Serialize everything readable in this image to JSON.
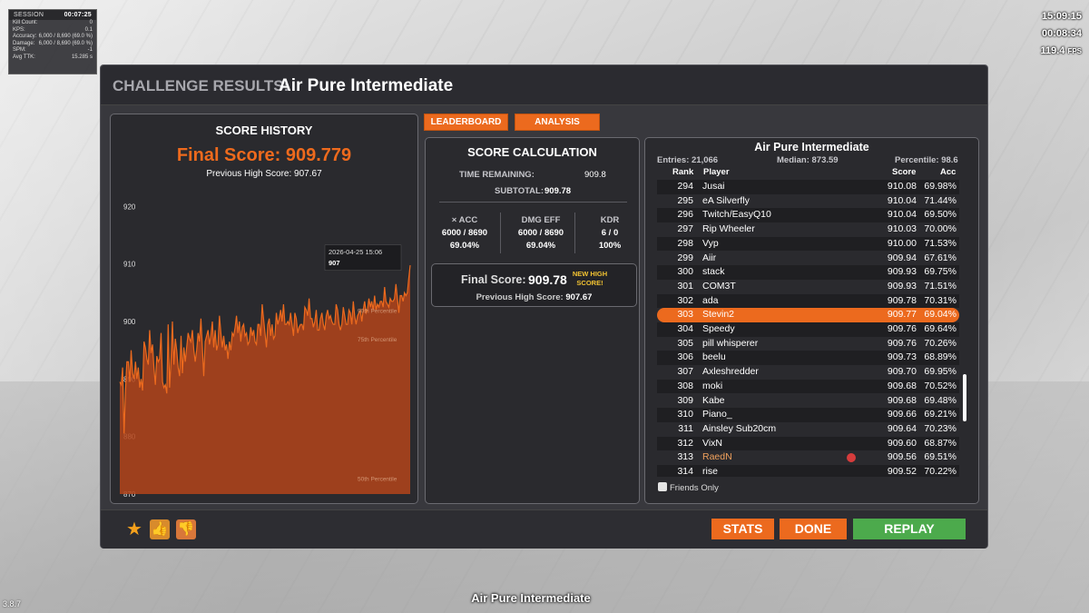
{
  "session": {
    "label": "SESSION",
    "time": "00:07:25",
    "stats": [
      {
        "k": "Kill Count:",
        "v": "0"
      },
      {
        "k": "KPS:",
        "v": "0.1"
      },
      {
        "k": "Accuracy:",
        "v": "6,000 / 8,690  (69.0 %)"
      },
      {
        "k": "Damage:",
        "v": "6,000 / 8,690  (69.0 %)"
      },
      {
        "k": "SPM:",
        "v": "-1"
      },
      {
        "k": "Avg TTK:",
        "v": "15.285 s"
      }
    ]
  },
  "hud": {
    "clock": "15:09:15",
    "timer": "00:08:34",
    "fps_value": "119.4",
    "fps_unit": "FPS"
  },
  "version": "3.8.7",
  "bottom_title": "Air Pure Intermediate",
  "window": {
    "label": "CHALLENGE RESULTS:",
    "name": "Air Pure Intermediate"
  },
  "history": {
    "title": "SCORE HISTORY",
    "final_score": "Final Score: 909.779",
    "previous_high": "Previous High Score: 907.67",
    "tooltip_date": "2026-04-25 15:06",
    "tooltip_value": "907",
    "percentile_labels": [
      "90th Percentile",
      "75th Percentile",
      "50th Percentile"
    ],
    "percentile_values": [
      901.5,
      896.5,
      872.3
    ]
  },
  "chart_data": {
    "type": "area",
    "title": "SCORE HISTORY",
    "yticks": [
      "920",
      "910",
      "900",
      "890",
      "880",
      "870"
    ],
    "ylim": [
      870,
      921
    ],
    "color": "#ec6a1e",
    "values": [
      889.5,
      889,
      892,
      880.5,
      888,
      893,
      893,
      889.5,
      895,
      891,
      890,
      893,
      890,
      892,
      888.5,
      890,
      888,
      896.5,
      895.5,
      893.5,
      892.5,
      898.5,
      894.5,
      896,
      892,
      889,
      894,
      893,
      893.5,
      898,
      889.5,
      888.5,
      889,
      887.5,
      899.5,
      888.5,
      893.5,
      900,
      892.5,
      897,
      895,
      892,
      890.5,
      897.5,
      891,
      895.5,
      893,
      895.5,
      898,
      897,
      896.5,
      898.5,
      895,
      893,
      895,
      898,
      896.5,
      900.5,
      895.5,
      890.5,
      896.5,
      897.5,
      898.5,
      896,
      897.5,
      900,
      895.5,
      898.5,
      895,
      896,
      901,
      898,
      895.5,
      897.5,
      895,
      896,
      893.5,
      896.5,
      895,
      898,
      897.5,
      899,
      901,
      898,
      900,
      896.5,
      899,
      899.5,
      897.5,
      898,
      896,
      896.5,
      899,
      897.5,
      898.5,
      896.5,
      896,
      899.5,
      899.5,
      897.5,
      903,
      900.5,
      898,
      895.5,
      899.5,
      900.5,
      897.5,
      899.5,
      897,
      897.5,
      901.5,
      899.5,
      900.5,
      902,
      900,
      903,
      899.5,
      899.5,
      900,
      899.5,
      901.5,
      899.5,
      897.5,
      901.5,
      900.5,
      898,
      899,
      899.5,
      899.5,
      898.5,
      902.5,
      902,
      901,
      904,
      900.5,
      900.5,
      899,
      900,
      902,
      898.5,
      898.5,
      900.5,
      901.5,
      899.5,
      898.5,
      901,
      902,
      900.5,
      901,
      900,
      899.5,
      899.5,
      903,
      902,
      899.5,
      898.5,
      899.5,
      902.5,
      901,
      899.5,
      899.5,
      902,
      901.5,
      899.5,
      903.5,
      901,
      899.5,
      901,
      901.5,
      902,
      900,
      902,
      903.5,
      901.5,
      902,
      904,
      902.5,
      903.5,
      902,
      904.5,
      902,
      903,
      902.5,
      903.5,
      903.5,
      902.5,
      906,
      903.5,
      903,
      902.5,
      904,
      903.5,
      903.5,
      904,
      906.5,
      904,
      901.5,
      904.5,
      904.5,
      903.5,
      905,
      904.5,
      905,
      907.5,
      909.779
    ]
  },
  "tabs": {
    "leaderboard": "LEADERBOARD",
    "analysis": "ANALYSIS"
  },
  "calc": {
    "title": "SCORE CALCULATION",
    "time_remaining_label": "TIME REMAINING:",
    "time_remaining_value": "909.8",
    "subtotal_label": "SUBTOTAL:",
    "subtotal_value": "909.78",
    "columns": [
      {
        "h": "× ACC",
        "v1": "6000 / 8690",
        "v2": "69.04%"
      },
      {
        "h": "DMG EFF",
        "v1": "6000 / 8690",
        "v2": "69.04%"
      },
      {
        "h": "KDR",
        "v1": "6 / 0",
        "v2": "100%"
      }
    ],
    "final_label": "Final Score:",
    "final_value": "909.78",
    "new_high_1": "NEW HIGH",
    "new_high_2": "SCORE!",
    "prev_label": "Previous High Score:",
    "prev_value": "907.67"
  },
  "leaderboard": {
    "title": "Air Pure Intermediate",
    "entries": "Entries: 21,066",
    "median": "Median: 873.59",
    "percentile": "Percentile: 98.6",
    "headers": {
      "rank": "Rank",
      "player": "Player",
      "score": "Score",
      "acc": "Acc"
    },
    "friends_only": "Friends Only",
    "rows": [
      {
        "rank": "294",
        "player": "Jusai",
        "score": "910.08",
        "acc": "69.98%"
      },
      {
        "rank": "295",
        "player": "eA Silverfly",
        "score": "910.04",
        "acc": "71.44%"
      },
      {
        "rank": "296",
        "player": "Twitch/EasyQ10",
        "score": "910.04",
        "acc": "69.50%"
      },
      {
        "rank": "297",
        "player": "Rip Wheeler",
        "score": "910.03",
        "acc": "70.00%"
      },
      {
        "rank": "298",
        "player": "Vyp",
        "score": "910.00",
        "acc": "71.53%"
      },
      {
        "rank": "299",
        "player": "Aiir",
        "score": "909.94",
        "acc": "67.61%"
      },
      {
        "rank": "300",
        "player": "stack",
        "score": "909.93",
        "acc": "69.75%"
      },
      {
        "rank": "301",
        "player": "COM3T",
        "score": "909.93",
        "acc": "71.51%"
      },
      {
        "rank": "302",
        "player": "ada",
        "score": "909.78",
        "acc": "70.31%"
      },
      {
        "rank": "303",
        "player": "Stevin2",
        "score": "909.77",
        "acc": "69.04%",
        "me": true
      },
      {
        "rank": "304",
        "player": "Speedy",
        "score": "909.76",
        "acc": "69.64%"
      },
      {
        "rank": "305",
        "player": "pill whisperer",
        "score": "909.76",
        "acc": "70.26%"
      },
      {
        "rank": "306",
        "player": "beelu",
        "score": "909.73",
        "acc": "68.89%"
      },
      {
        "rank": "307",
        "player": "Axleshredder",
        "score": "909.70",
        "acc": "69.95%"
      },
      {
        "rank": "308",
        "player": "moki",
        "score": "909.68",
        "acc": "70.52%"
      },
      {
        "rank": "309",
        "player": "Kabe",
        "score": "909.68",
        "acc": "69.48%"
      },
      {
        "rank": "310",
        "player": "Piano_",
        "score": "909.66",
        "acc": "69.21%"
      },
      {
        "rank": "311",
        "player": "Ainsley Sub20cm",
        "score": "909.64",
        "acc": "70.23%"
      },
      {
        "rank": "312",
        "player": "VixN",
        "score": "909.60",
        "acc": "68.87%"
      },
      {
        "rank": "313",
        "player": "RaedN",
        "score": "909.56",
        "acc": "69.51%",
        "friend": true
      },
      {
        "rank": "314",
        "player": "rise",
        "score": "909.52",
        "acc": "70.22%"
      }
    ]
  },
  "footer": {
    "stats": "STATS",
    "done": "DONE",
    "replay": "REPLAY"
  }
}
